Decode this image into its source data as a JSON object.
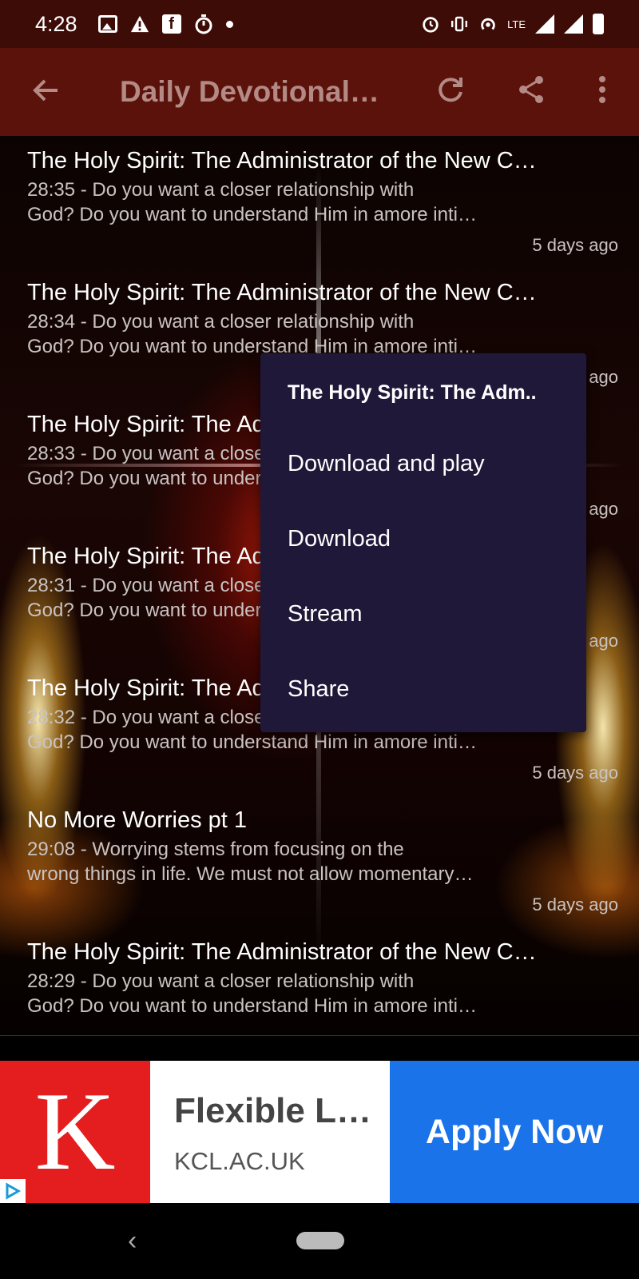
{
  "status_bar": {
    "time": "4:28",
    "network": "LTE"
  },
  "app_bar": {
    "title": "Daily Devotional…",
    "back_icon": "arrow-left-icon",
    "refresh_icon": "refresh-icon",
    "share_icon": "share-icon",
    "overflow_icon": "more-vert-icon"
  },
  "episodes": [
    {
      "title": "The Holy Spirit: The Administrator of the New C…",
      "desc_line1": "28:35 - Do you want a closer relationship with",
      "desc_line2": "God? Do you want to understand Him in amore inti…",
      "ago": "5 days ago"
    },
    {
      "title": "The Holy Spirit: The Administrator of the New C…",
      "desc_line1": "28:34 - Do you want a closer relationship with",
      "desc_line2": "God? Do you want to understand Him in amore inti…",
      "ago": "5 days ago"
    },
    {
      "title": "The Holy Spirit: The Administrator of the New C…",
      "desc_line1": "28:33 - Do you want a closer relationship with",
      "desc_line2": "God? Do you want to understand Him in amore inti…",
      "ago": "5 days ago"
    },
    {
      "title": "The Holy Spirit: The Administrator of the New C…",
      "desc_line1": "28:31 - Do you want a closer relationship with",
      "desc_line2": "God? Do you want to understand Him in amore inti…",
      "ago": "5 days ago"
    },
    {
      "title": "The Holy Spirit: The Administrator of the New C…",
      "desc_line1": "28:32 - Do you want a closer relationship with",
      "desc_line2": "God? Do you want to understand Him in amore inti…",
      "ago": "5 days ago"
    },
    {
      "title": "No More Worries pt 1",
      "desc_line1": "29:08 - Worrying stems from focusing on the",
      "desc_line2": "wrong things in life. We must not allow momentary…",
      "ago": "5 days ago"
    },
    {
      "title": "The Holy Spirit: The Administrator of the New C…",
      "desc_line1": "28:29 - Do you want a closer relationship with",
      "desc_line2": "God? Do vou want to understand Him in amore inti…",
      "ago": ""
    }
  ],
  "context_menu": {
    "header": "The Holy Spirit: The Adm..",
    "items": [
      "Download and play",
      "Download",
      "Stream",
      "Share"
    ]
  },
  "ad": {
    "logo_letter": "K",
    "headline": "Flexible L…",
    "domain": "KCL.AC.UK",
    "cta": "Apply Now",
    "colors": {
      "logo_bg": "#e41e1e",
      "cta_bg": "#1a73e8"
    }
  },
  "colors": {
    "status_bar": "#3e0c07",
    "app_bar": "#5b120b",
    "menu_bg": "#201839"
  }
}
